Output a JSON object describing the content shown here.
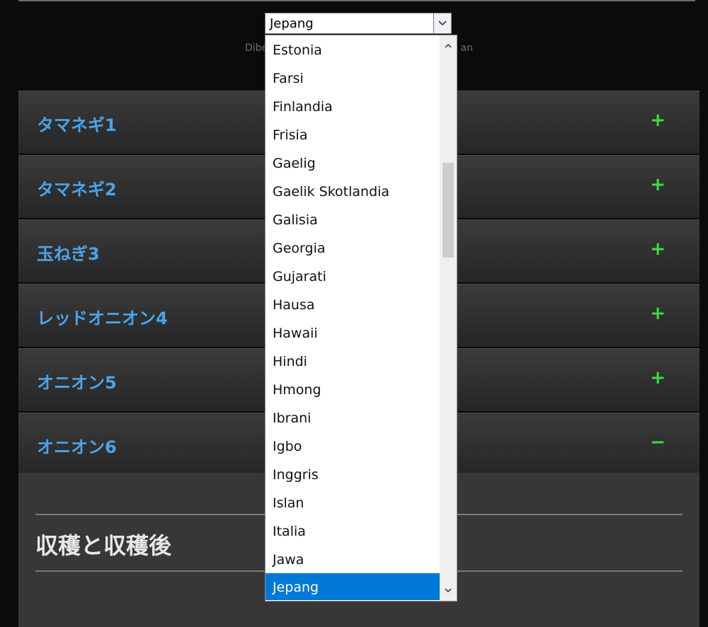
{
  "language_select": {
    "selected": "Jepang",
    "options": [
      "Estonia",
      "Farsi",
      "Finlandia",
      "Frisia",
      "Gaelig",
      "Gaelik Skotlandia",
      "Galisia",
      "Georgia",
      "Gujarati",
      "Hausa",
      "Hawaii",
      "Hindi",
      "Hmong",
      "Ibrani",
      "Igbo",
      "Inggris",
      "Islan",
      "Italia",
      "Jawa",
      "Jepang"
    ],
    "highlighted": "Jepang"
  },
  "powered_by": {
    "start": "Dibe",
    "end": "an"
  },
  "accordion": {
    "items": [
      {
        "title": "タマネギ1",
        "sign": "+"
      },
      {
        "title": "タマネギ2",
        "sign": "+"
      },
      {
        "title": "玉ねぎ3",
        "sign": "+"
      },
      {
        "title": "レッドオニオン4",
        "sign": "+"
      },
      {
        "title": "オニオン5",
        "sign": "+"
      },
      {
        "title": "オニオン6",
        "sign": "−"
      }
    ]
  },
  "section": {
    "heading": "収穫と収穫後"
  },
  "colors": {
    "accent_title": "#4aa3e8",
    "toggle": "#36e23a",
    "selection": "#0078d7"
  }
}
